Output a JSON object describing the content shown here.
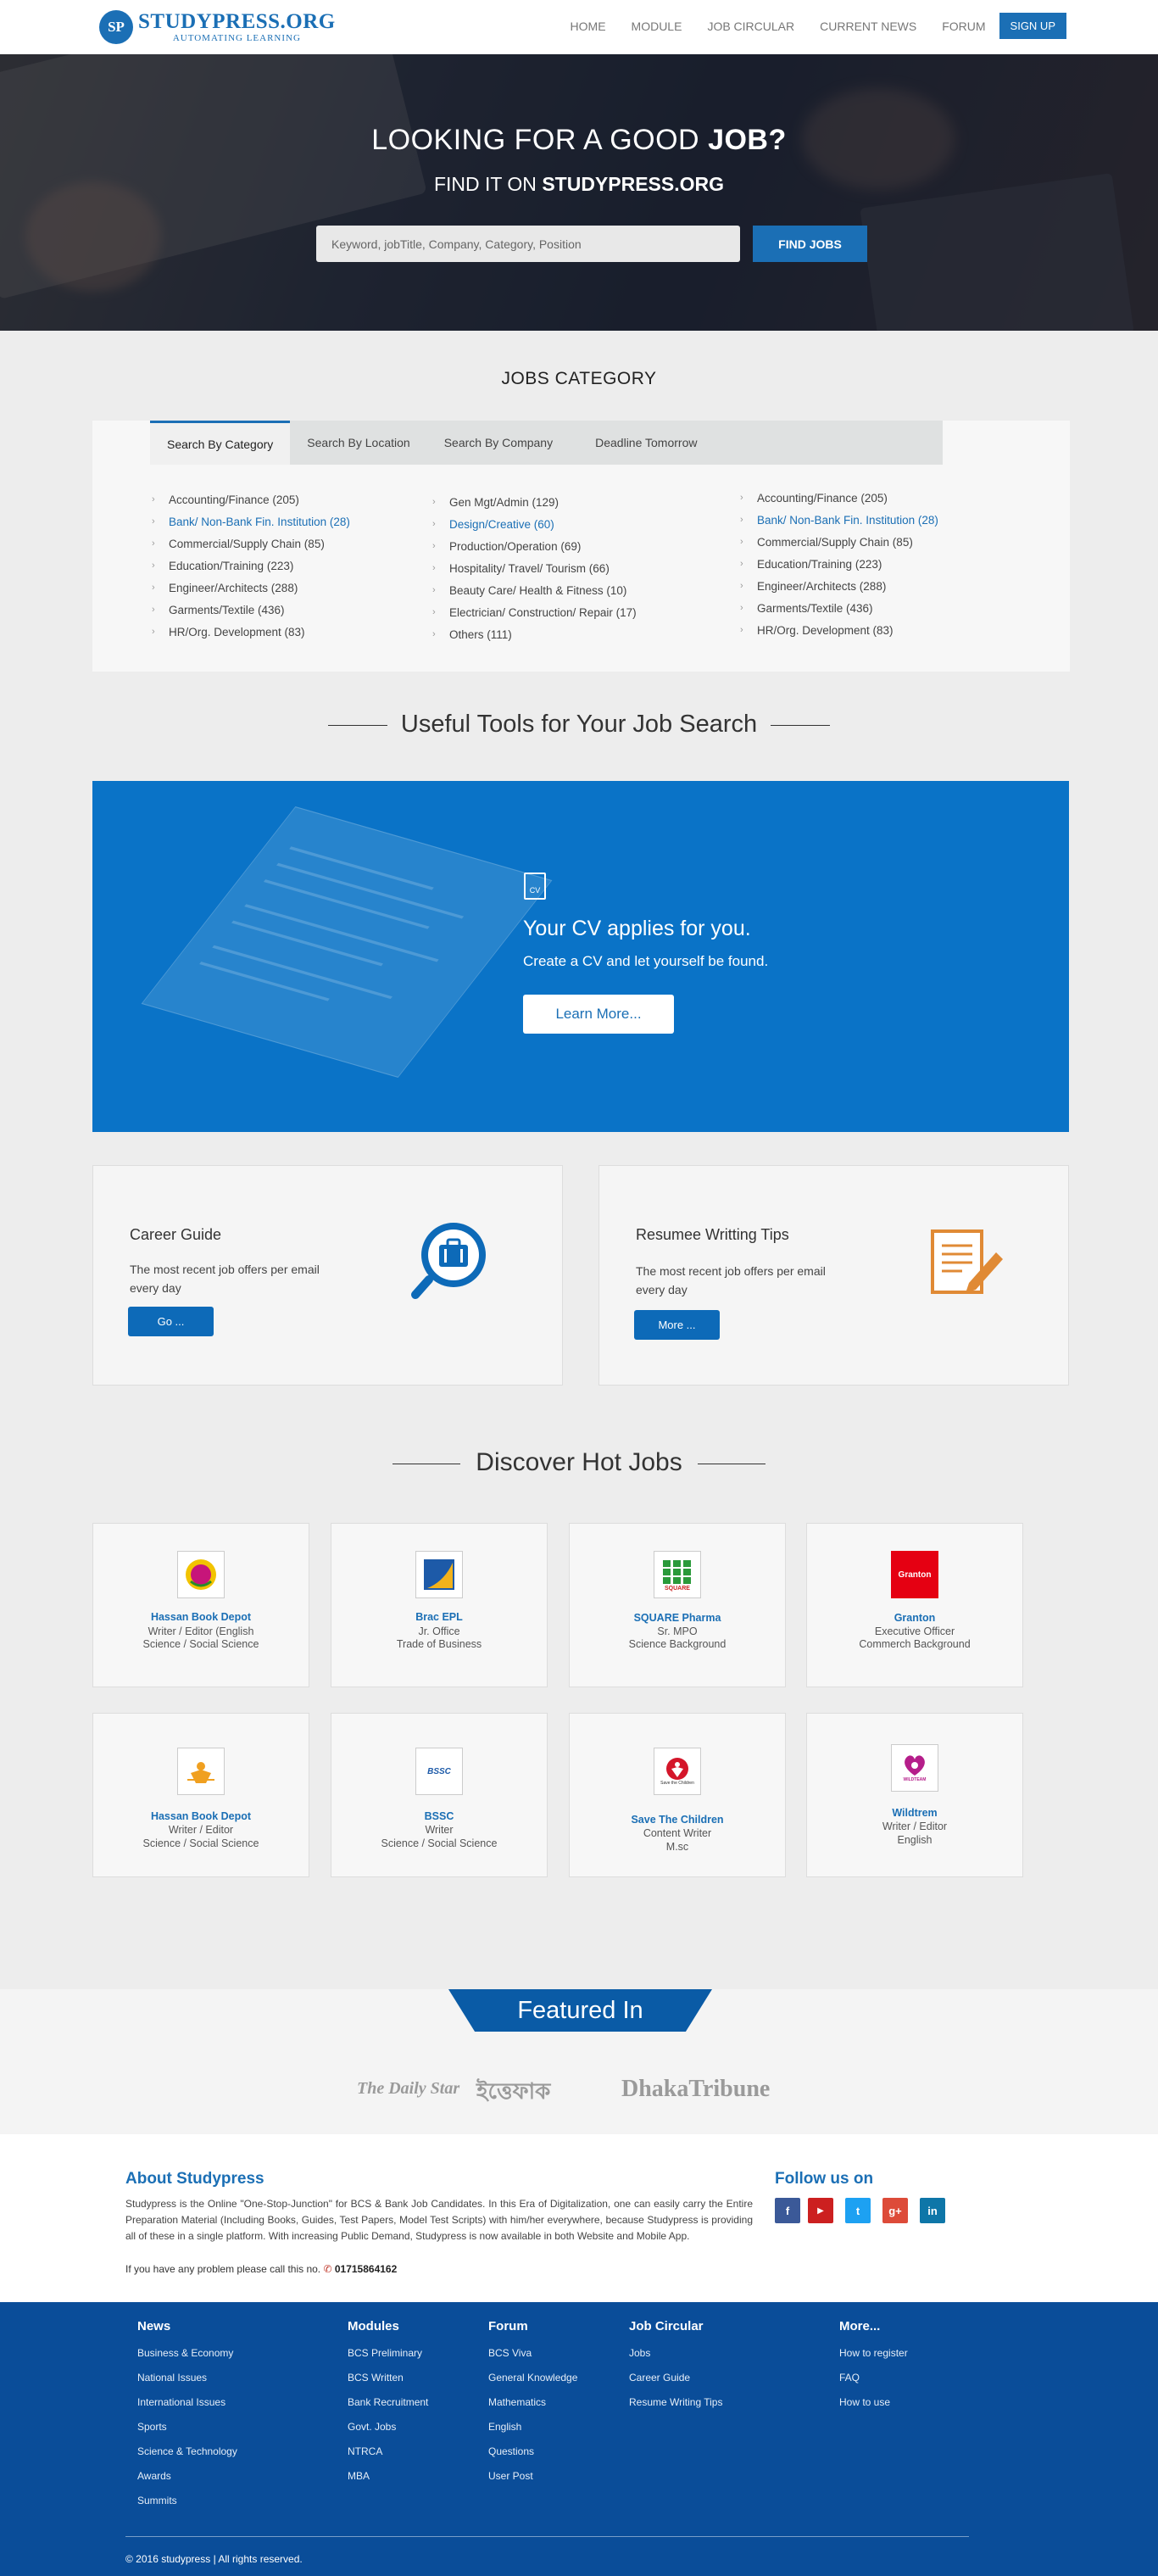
{
  "nav": {
    "logo_mark": "SP",
    "logo_name": "STUDYPRESS.ORG",
    "logo_tagline": "AUTOMATING LEARNING",
    "links": [
      "HOME",
      "MODULE",
      "JOB CIRCULAR",
      "CURRENT NEWS",
      "FORUM"
    ],
    "signup": "SIGN UP"
  },
  "hero": {
    "title_light": "LOOKING FOR A GOOD ",
    "title_bold": "JOB?",
    "subtitle_light": "FIND IT ON ",
    "subtitle_bold": "STUDYPRESS.ORG",
    "search_placeholder": "Keyword, jobTitle, Company, Category, Position",
    "find_button": "FIND JOBS"
  },
  "jobs_category": {
    "title": "JOBS CATEGORY",
    "tabs": [
      "Search By Category",
      "Search By Location",
      "Search By Company",
      "Deadline Tomorrow"
    ],
    "columns": [
      [
        "Accounting/Finance (205)",
        "Bank/ Non-Bank Fin. Institution (28)",
        "Commercial/Supply Chain (85)",
        "Education/Training (223)",
        "Engineer/Architects (288)",
        "Garments/Textile (436)",
        "HR/Org. Development (83)"
      ],
      [
        "Gen Mgt/Admin (129)",
        "Design/Creative (60)",
        "Production/Operation (69)",
        "Hospitality/ Travel/ Tourism (66)",
        "Beauty Care/ Health & Fitness (10)",
        "Electrician/ Construction/ Repair (17)",
        "Others (111)"
      ],
      [
        "Accounting/Finance (205)",
        "Bank/ Non-Bank Fin. Institution (28)",
        "Commercial/Supply Chain (85)",
        "Education/Training (223)",
        "Engineer/Architects (288)",
        "Garments/Textile (436)",
        "HR/Org. Development (83)"
      ]
    ]
  },
  "useful_tools": {
    "title": "Useful Tools for Your Job Search",
    "cv_icon": "CV",
    "cv_heading": "Your CV applies for you.",
    "cv_sub": "Create a CV and let yourself be found.",
    "cv_button": "Learn More..."
  },
  "guides": [
    {
      "title": "Career Guide",
      "text": "The most recent job offers per email every day",
      "button": "Go ...",
      "icon": "briefcase-search-icon"
    },
    {
      "title": "Resumee Writting Tips",
      "text": "The most recent job offers per email every day",
      "button": "More ...",
      "icon": "document-pen-icon"
    }
  ],
  "hot_jobs": {
    "title": "Discover Hot Jobs",
    "jobs": [
      {
        "company": "Hassan Book Depot",
        "lines": [
          "Writer / Editor (English",
          "Science / Social Science"
        ],
        "logo": "hassan-logo-icon"
      },
      {
        "company": "Brac EPL",
        "lines": [
          "Jr. Office",
          "Trade of Business"
        ],
        "logo": "brac-logo-icon"
      },
      {
        "company": "SQUARE Pharma",
        "lines": [
          "Sr. MPO",
          "Science Background"
        ],
        "logo": "square-logo-icon",
        "logo_text": "SQUARE"
      },
      {
        "company": "Granton",
        "lines": [
          "Executive Officer",
          "Commerch Background"
        ],
        "logo": "granton-logo-icon",
        "logo_text": "Granton"
      },
      {
        "company": "Hassan Book Depot",
        "lines": [
          "Writer / Editor",
          "Science / Social Science"
        ],
        "logo": "hassan-logo-icon"
      },
      {
        "company": "BSSC",
        "lines": [
          "Writer",
          "Science / Social Science"
        ],
        "logo": "bssc-logo-icon",
        "logo_text": "BSSC"
      },
      {
        "company": "Save The Children",
        "lines": [
          "Content Writer",
          "M.sc"
        ],
        "logo": "save-children-logo-icon",
        "logo_text": "Save the Children"
      },
      {
        "company": "Wildtrem",
        "lines": [
          "Writer / Editor",
          "English"
        ],
        "logo": "wildtrem-logo-icon",
        "logo_text": "WILDTEAM"
      }
    ]
  },
  "featured": {
    "title": "Featured In",
    "logos": [
      "The Daily Star",
      "ইত্তেফাক",
      "DhakaTribune"
    ]
  },
  "about": {
    "title": "About Studypress",
    "text": "Studypress is the Online \"One-Stop-Junction\" for BCS & Bank Job Candidates. In this Era of Digitalization, one can easily carry the Entire Preparation Material (Including Books, Guides, Test Papers, Model Test Scripts) with him/her everywhere, because Studypress is providing all of these in a single platform. With increasing Public Demand, Studypress is now available in both Website and Mobile App.",
    "call_text": "If you have any problem please call this no. ",
    "phone": "01715864162",
    "follow_title": "Follow us on",
    "social": [
      {
        "label": "f",
        "color": "#3b5998",
        "icon": "facebook-icon"
      },
      {
        "label": "▶",
        "color": "#cc2020",
        "icon": "youtube-icon"
      },
      {
        "label": "t",
        "color": "#1da1f2",
        "icon": "twitter-icon"
      },
      {
        "label": "g+",
        "color": "#dd4b39",
        "icon": "google-plus-icon"
      },
      {
        "label": "in",
        "color": "#0e76a8",
        "icon": "linkedin-icon"
      }
    ]
  },
  "footer": {
    "columns": [
      {
        "title": "News",
        "items": [
          "Business & Economy",
          "National Issues",
          "International Issues",
          "Sports",
          "Science & Technology",
          "Awards",
          "Summits"
        ]
      },
      {
        "title": "Modules",
        "items": [
          "BCS Preliminary",
          "BCS Written",
          "Bank Recruitment",
          "Govt. Jobs",
          "NTRCA",
          "MBA"
        ]
      },
      {
        "title": "Forum",
        "items": [
          "BCS Viva",
          "General Knowledge",
          "Mathematics",
          "English",
          "Questions",
          "User Post"
        ]
      },
      {
        "title": "Job Circular",
        "items": [
          "Jobs",
          "Career Guide",
          "Resume Writing Tips"
        ]
      },
      {
        "title": "More...",
        "items": [
          "How to register",
          "FAQ",
          "How to use"
        ]
      }
    ],
    "copyright": "© 2016 studypress | All rights reserved."
  }
}
